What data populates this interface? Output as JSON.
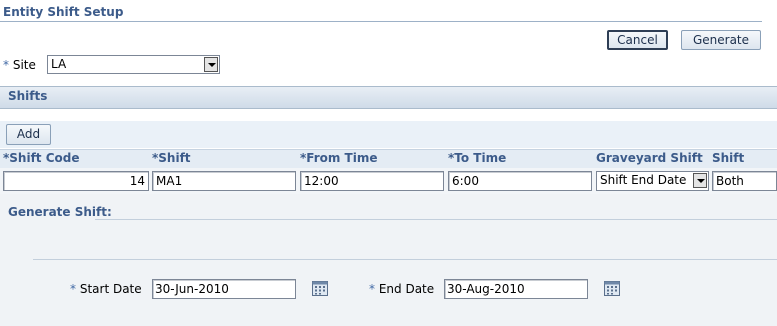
{
  "page": {
    "title": "Entity Shift Setup"
  },
  "actions": {
    "cancel": "Cancel",
    "generate": "Generate"
  },
  "site": {
    "required_mark": "*",
    "label": "Site",
    "value": "LA"
  },
  "shifts": {
    "section_title": "Shifts",
    "add_label": "Add",
    "columns": [
      {
        "required": "*",
        "label": "Shift Code"
      },
      {
        "required": "*",
        "label": "Shift"
      },
      {
        "required": "*",
        "label": "From Time"
      },
      {
        "required": "*",
        "label": "To Time"
      },
      {
        "required": "",
        "label": "Graveyard Shift"
      },
      {
        "required": "",
        "label": "Shift Type"
      }
    ],
    "rows": [
      {
        "shift_code": "14",
        "shift": "MA1",
        "from_time": "12:00",
        "to_time": "6:00",
        "graveyard_shift": "Shift End Date",
        "shift_type": "Both"
      }
    ]
  },
  "generate_shift": {
    "section_title": "Generate Shift:",
    "start_date": {
      "required_mark": "*",
      "label": "Start Date",
      "value": "30-Jun-2010",
      "icon": "calendar-icon"
    },
    "end_date": {
      "required_mark": "*",
      "label": "End Date",
      "value": "30-Aug-2010",
      "icon": "calendar-icon"
    }
  },
  "colors": {
    "accent": "#3c5b8a",
    "header_bg": "#cfdbe8",
    "required": "#4169a5"
  }
}
